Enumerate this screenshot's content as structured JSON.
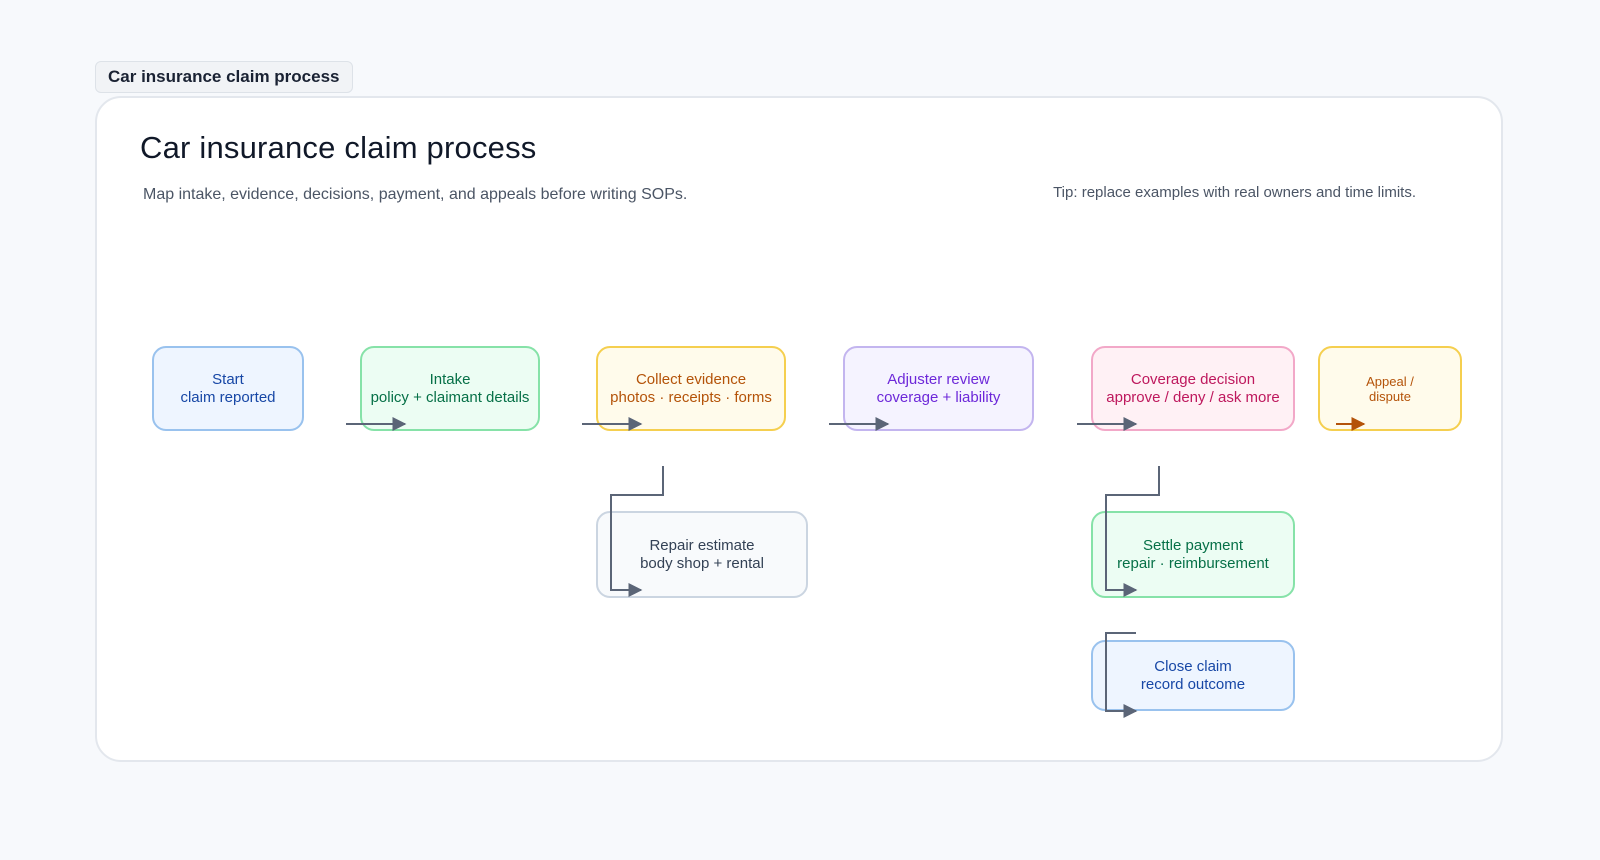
{
  "tab": {
    "label": "Car insurance claim process"
  },
  "header": {
    "title": "Car insurance claim process",
    "subtitle": "Map intake, evidence, decisions, payment, and appeals before writing SOPs.",
    "tip": "Tip: replace examples with real owners and time limits."
  },
  "nodes": {
    "start": {
      "line1": "Start",
      "line2": "claim reported"
    },
    "intake": {
      "line1": "Intake",
      "line2": "policy + claimant details"
    },
    "evidence": {
      "line1": "Collect evidence",
      "line2": "photos · receipts · forms"
    },
    "adjuster": {
      "line1": "Adjuster review",
      "line2": "coverage + liability"
    },
    "decision": {
      "line1": "Coverage decision",
      "line2": "approve / deny / ask more"
    },
    "appeal": {
      "line1": "Appeal /",
      "line2": "dispute"
    },
    "repair": {
      "line1": "Repair estimate",
      "line2": "body shop + rental"
    },
    "settle": {
      "line1": "Settle payment",
      "line2": "repair · reimbursement"
    },
    "close": {
      "line1": "Close claim",
      "line2": "record outcome"
    }
  },
  "colors": {
    "connector": "#5b6577",
    "appeal_connector": "#b45309"
  }
}
